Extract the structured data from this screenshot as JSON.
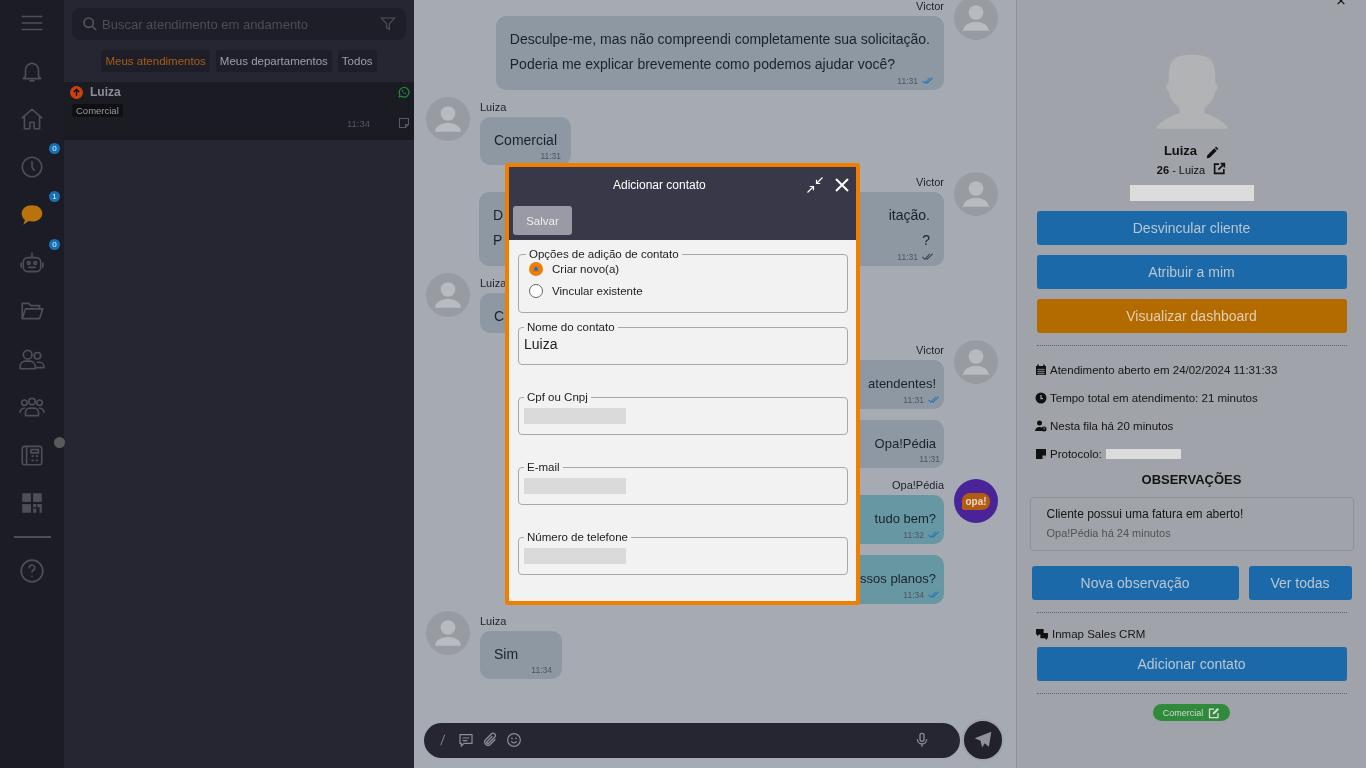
{
  "rail": {
    "items": [
      {
        "kind": "menu",
        "selected": false,
        "dot": false
      },
      {
        "kind": "bell",
        "selected": false,
        "dot": false
      },
      {
        "kind": "home",
        "selected": false,
        "dot": false
      },
      {
        "kind": "clock",
        "badge": "0",
        "selected": false,
        "dot": false
      },
      {
        "kind": "chat",
        "badge": "1",
        "selected": true,
        "dot": false
      },
      {
        "kind": "robot",
        "badge": "0",
        "selected": false,
        "dot": false
      },
      {
        "kind": "folder",
        "selected": false,
        "dot": false
      },
      {
        "kind": "users",
        "selected": false,
        "dot": false
      },
      {
        "kind": "group",
        "selected": false,
        "dot": false
      },
      {
        "kind": "phone",
        "selected": false,
        "dot": true
      },
      {
        "kind": "qr",
        "selected": false,
        "dot": false
      },
      {
        "kind": "divider"
      },
      {
        "kind": "help",
        "selected": false,
        "dot": false
      }
    ]
  },
  "conversations": {
    "search": {
      "placeholder": "Buscar atendimento em andamento"
    },
    "filters": [
      {
        "label": "Meus atendimentos",
        "selected": true
      },
      {
        "label": "Meus departamentos",
        "selected": false
      },
      {
        "label": "Todos",
        "selected": false
      }
    ],
    "items": [
      {
        "name": "Luiza",
        "tag": "Comercial",
        "time": "11:34",
        "selected": true
      }
    ]
  },
  "chat": {
    "messages": [
      {
        "kind": "agent",
        "sender": "Victor",
        "lines": [
          {
            "head": "Desculpe-me, mas não compreendi completamente sua solicitação."
          },
          {
            "head": "Poderia me explicar brevemente como podemos ajudar você?"
          }
        ],
        "time": "11:31",
        "delivered": true,
        "read": true
      },
      {
        "kind": "client",
        "sender": "Luiza",
        "lines": [
          {
            "head": "Comercial"
          }
        ],
        "time": "11:31",
        "delivered": false,
        "read": false
      },
      {
        "kind": "agent",
        "sender": "Victor",
        "lines": [
          {
            "head": "D",
            "tail": "itação."
          },
          {
            "head": "P",
            "tail": "?"
          }
        ],
        "time": "11:31",
        "delivered": true,
        "read": false
      },
      {
        "kind": "client",
        "sender": "Luiza",
        "lines": [
          {
            "head": "C"
          }
        ],
        "delivered": false,
        "read": false
      },
      {
        "kind": "agent",
        "sender": "Victor",
        "lines": [
          {
            "tail": "atendentes!"
          }
        ],
        "time": "11:31",
        "delivered": true,
        "read": true
      },
      {
        "kind": "agent",
        "lines": [
          {
            "tail": "Opa!Pédia"
          }
        ],
        "time": "11:31",
        "delivered": false,
        "read": false
      },
      {
        "kind": "bot",
        "sender": "Opa!Pédia",
        "avatar_text": "opa!",
        "lines": [
          {
            "tail": "tudo bem?"
          }
        ],
        "time": "11:32",
        "delivered": true,
        "read": true
      },
      {
        "kind": "bot",
        "lines": [
          {
            "tail": "ssos planos?"
          }
        ],
        "time": "11:34",
        "delivered": true,
        "read": true
      },
      {
        "kind": "client",
        "sender": "Luiza",
        "lines": [
          {
            "head": "Sim"
          }
        ],
        "time": "11:34",
        "delivered": false,
        "read": false
      }
    ]
  },
  "details": {
    "name": "Luiza",
    "contact": "**26** - Luiza",
    "phone": {
      "redacted": true
    },
    "buttons": [
      {
        "label": "Desvincular cliente",
        "kind": "primary"
      },
      {
        "label": "Atribuir a mim",
        "kind": "primary"
      },
      {
        "label": "Visualizar dashboard",
        "kind": "warning"
      }
    ],
    "info": [
      {
        "kind": "calendar",
        "text": "Atendimento aberto em 24/02/2024 11:31:33"
      },
      {
        "kind": "clock",
        "text": "Tempo total em atendimento: 21 minutos"
      },
      {
        "kind": "user-clock",
        "text": "Nesta fila há 20 minutos"
      },
      {
        "kind": "note",
        "text": "Protocolo:",
        "redacted": true
      }
    ],
    "notes_title": "OBSERVAÇÕES",
    "notes": [
      {
        "text": "Cliente possui uma fatura em aberto!",
        "meta": "Opa!Pédia há 24 minutos"
      }
    ],
    "note_buttons": [
      "Nova observação",
      "Ver todas"
    ],
    "integration": {
      "name": "Inmap Sales CRM",
      "button": "Adicionar contato"
    },
    "tag": {
      "label": "Comercial",
      "color": "#2f8a3c"
    }
  },
  "dialog": {
    "title": "Adicionar contato",
    "save": "Salvar",
    "options": {
      "legend": "Opções de adição de contato",
      "choices": [
        {
          "label": "Criar novo(a)",
          "selected": true
        },
        {
          "label": "Vincular existente",
          "selected": false
        }
      ]
    },
    "fields": [
      {
        "label": "Nome do contato",
        "value": "Luiza"
      },
      {
        "label": "Cpf ou Cnpj",
        "redacted": true
      },
      {
        "label": "E-mail",
        "redacted": true
      },
      {
        "label": "Número de telefone",
        "redacted": true
      }
    ]
  }
}
